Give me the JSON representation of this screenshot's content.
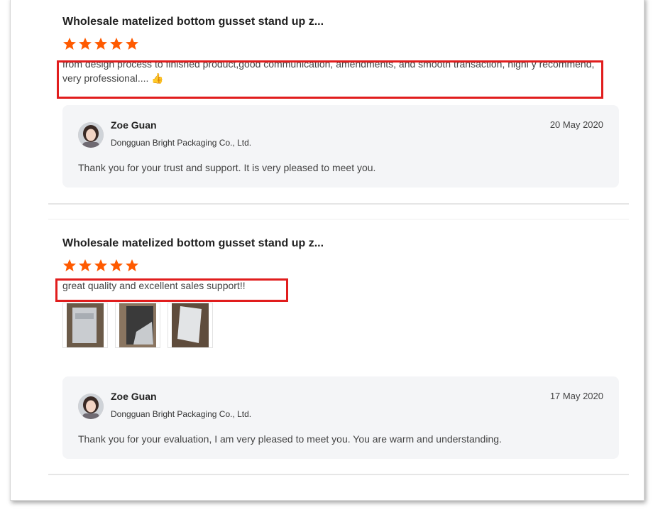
{
  "reviews": [
    {
      "title": "Wholesale matelized bottom gusset stand up z...",
      "rating": 5,
      "comment": "from design process to finished product,good communication, amendments, and smooth transaction, highl y recommend, very professional.... 👍",
      "thumbnails": [],
      "reply": {
        "name": "Zoe Guan",
        "company": "Dongguan Bright Packaging Co., Ltd.",
        "date": "20 May 2020",
        "text": "Thank you for your trust and support. It is very pleased to meet you."
      }
    },
    {
      "title": "Wholesale matelized bottom gusset stand up z...",
      "rating": 5,
      "comment": "great quality and excellent sales support!!",
      "thumbnails": [
        "photo-1",
        "photo-2",
        "photo-3"
      ],
      "reply": {
        "name": "Zoe Guan",
        "company": "Dongguan Bright Packaging Co., Ltd.",
        "date": "17 May 2020",
        "text": "Thank you for your evaluation,  I am very pleased to meet you. You are warm and understanding."
      }
    }
  ],
  "colors": {
    "star": "#ff5a00",
    "highlight": "#e11d1d",
    "reply_bg": "#f4f5f7"
  }
}
